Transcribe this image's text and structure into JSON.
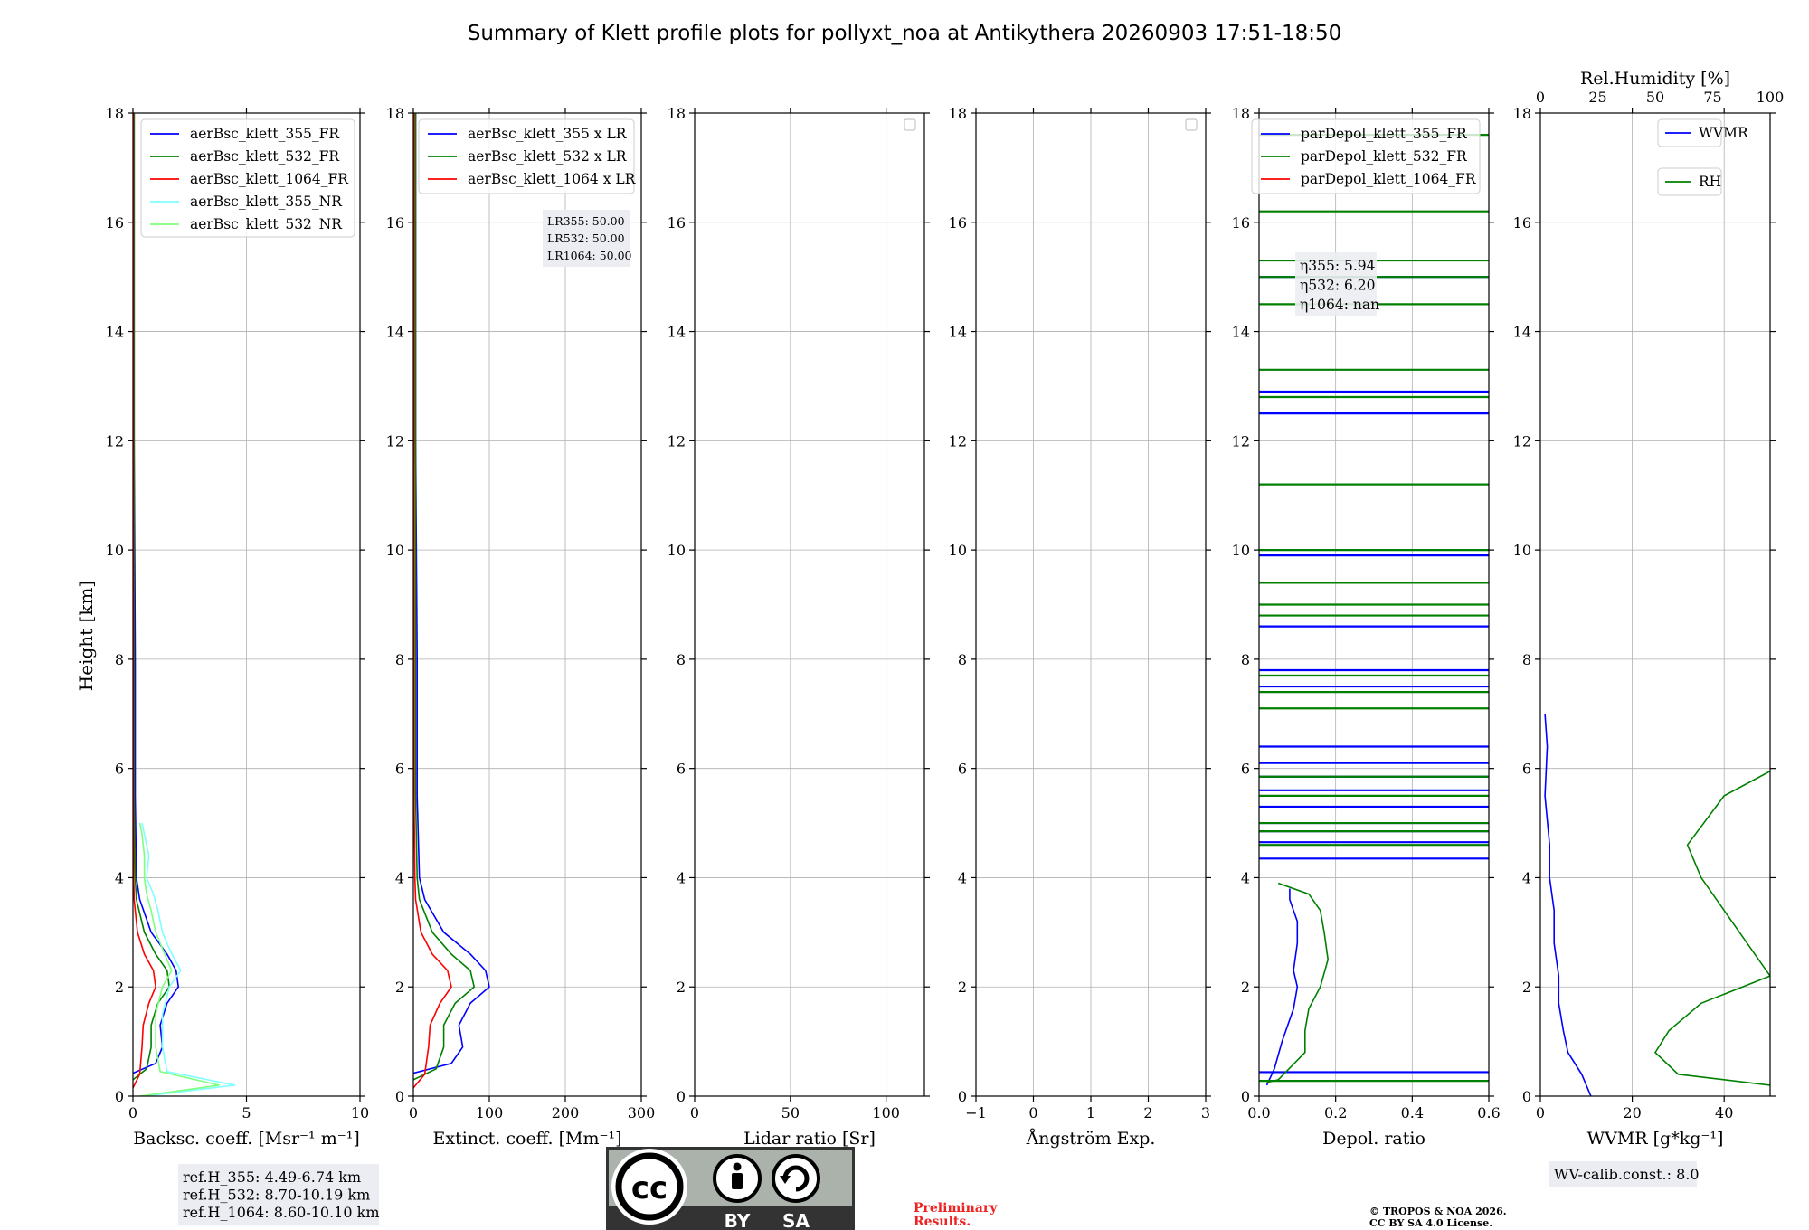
{
  "title": "Summary of Klett profile plots for pollyxt_noa at Antikythera 20260903 17:51-18:50",
  "ylabel": "Height [km]",
  "colors": {
    "b355": "#0000ff",
    "b532": "#008000",
    "b1064": "#ff0000",
    "nr355": "#7fffff",
    "nr532": "#7fff7f",
    "wvmr": "#0000ff",
    "rh": "#008000",
    "preliminary": "#ee2222",
    "cc_bg": "#aab2ab",
    "cc_dark": "#333333"
  },
  "chart_data": [
    {
      "type": "line",
      "panel": "backscatter",
      "xlabel": "Backsc. coeff. [Msr⁻¹ m⁻¹]",
      "xlim": [
        0,
        10
      ],
      "xticks": [
        "0",
        "5",
        "10"
      ],
      "ylim": [
        0,
        18
      ],
      "yticks": [
        "0",
        "2",
        "4",
        "6",
        "8",
        "10",
        "12",
        "14",
        "16",
        "18"
      ],
      "grid": true,
      "legend_placement": "top-right",
      "series": [
        {
          "name": "aerBsc_klett_355_FR",
          "color_key": "b355",
          "x": [
            0,
            1.0,
            1.3,
            1.2,
            1.5,
            2.0,
            1.9,
            1.5,
            0.8,
            0.3,
            0.15,
            0.1,
            0.1,
            0.05,
            0.05
          ],
          "y": [
            0.42,
            0.6,
            0.9,
            1.3,
            1.7,
            2.0,
            2.3,
            2.6,
            3.0,
            3.6,
            4.0,
            5.5,
            8.0,
            12.0,
            18.0
          ]
        },
        {
          "name": "aerBsc_klett_532_FR",
          "color_key": "b532",
          "x": [
            0,
            0.6,
            0.8,
            0.8,
            1.1,
            1.6,
            1.5,
            1.0,
            0.5,
            0.15,
            0.1,
            0.05,
            0.05,
            0.05,
            0.05
          ],
          "y": [
            0.3,
            0.5,
            0.9,
            1.3,
            1.7,
            2.0,
            2.3,
            2.6,
            3.0,
            3.6,
            4.0,
            5.5,
            8.0,
            12.0,
            18.0
          ]
        },
        {
          "name": "aerBsc_klett_1064_FR",
          "color_key": "b1064",
          "x": [
            0,
            0.3,
            0.4,
            0.45,
            0.7,
            1.0,
            0.9,
            0.5,
            0.2,
            0.05,
            0.03,
            0.02,
            0.02,
            0.02,
            0.02
          ],
          "y": [
            0.15,
            0.4,
            0.9,
            1.3,
            1.7,
            2.0,
            2.3,
            2.6,
            3.0,
            3.6,
            4.0,
            5.5,
            8.0,
            12.0,
            18.0
          ]
        },
        {
          "name": "aerBsc_klett_355_NR",
          "color_key": "nr355",
          "x": [
            0.5,
            4.5,
            1.5,
            1.3,
            1.3,
            1.6,
            2.1,
            1.6,
            1.3,
            1.1,
            0.9,
            0.6,
            0.7,
            0.5,
            0.4
          ],
          "y": [
            0.0,
            0.2,
            0.45,
            0.9,
            1.5,
            2.0,
            2.3,
            2.7,
            3.0,
            3.4,
            3.7,
            4.0,
            4.4,
            4.8,
            5.0
          ]
        },
        {
          "name": "aerBsc_klett_532_NR",
          "color_key": "nr532",
          "x": [
            0.3,
            3.8,
            1.2,
            1.0,
            1.0,
            1.3,
            1.7,
            1.3,
            1.0,
            0.8,
            0.6,
            0.5,
            0.5,
            0.4,
            0.3
          ],
          "y": [
            0.0,
            0.2,
            0.45,
            0.9,
            1.5,
            2.0,
            2.3,
            2.7,
            3.0,
            3.4,
            3.7,
            4.0,
            4.4,
            4.8,
            5.0
          ]
        }
      ],
      "annotation": [
        "ref.H_355: 4.49-6.74 km",
        "ref.H_532: 8.70-10.19 km",
        "ref.H_1064: 8.60-10.10 km"
      ]
    },
    {
      "type": "line",
      "panel": "extinction",
      "xlabel": "Extinct. coeff. [Mm⁻¹]",
      "xlim": [
        0,
        300
      ],
      "xticks": [
        "0",
        "100",
        "200",
        "300"
      ],
      "ylim": [
        0,
        18
      ],
      "yticks": [
        "0",
        "2",
        "4",
        "6",
        "8",
        "10",
        "12",
        "14",
        "16",
        "18"
      ],
      "grid": true,
      "legend_placement": "top-right",
      "series": [
        {
          "name": "aerBsc_klett_355 x LR",
          "color_key": "b355",
          "x": [
            0,
            50,
            65,
            60,
            75,
            100,
            95,
            75,
            40,
            15,
            8,
            5,
            5,
            3,
            3
          ],
          "y": [
            0.42,
            0.6,
            0.9,
            1.3,
            1.7,
            2.0,
            2.3,
            2.6,
            3.0,
            3.6,
            4.0,
            5.5,
            8.0,
            12.0,
            18.0
          ]
        },
        {
          "name": "aerBsc_klett_532 x LR",
          "color_key": "b532",
          "x": [
            0,
            30,
            40,
            40,
            55,
            80,
            75,
            50,
            25,
            8,
            5,
            3,
            3,
            3,
            3
          ],
          "y": [
            0.3,
            0.5,
            0.9,
            1.3,
            1.7,
            2.0,
            2.3,
            2.6,
            3.0,
            3.6,
            4.0,
            5.5,
            8.0,
            12.0,
            18.0
          ]
        },
        {
          "name": "aerBsc_klett_1064 x LR",
          "color_key": "b1064",
          "x": [
            0,
            15,
            20,
            22,
            35,
            50,
            45,
            25,
            10,
            3,
            2,
            1,
            1,
            1,
            1
          ],
          "y": [
            0.15,
            0.4,
            0.9,
            1.3,
            1.7,
            2.0,
            2.3,
            2.6,
            3.0,
            3.6,
            4.0,
            5.5,
            8.0,
            12.0,
            18.0
          ]
        }
      ],
      "annotation": [
        "LR355: 50.00",
        "LR532: 50.00",
        "LR1064: 50.00"
      ]
    },
    {
      "type": "line",
      "panel": "lidar-ratio",
      "xlabel": "Lidar ratio [Sr]",
      "xlim": [
        0,
        120
      ],
      "xticks": [
        "0",
        "50",
        "100"
      ],
      "ylim": [
        0,
        18
      ],
      "yticks": [
        "0",
        "2",
        "4",
        "6",
        "8",
        "10",
        "12",
        "14",
        "16",
        "18"
      ],
      "grid": true,
      "series": []
    },
    {
      "type": "line",
      "panel": "angstrom",
      "xlabel": "Ångström Exp.",
      "xlim": [
        -1,
        3
      ],
      "xticks": [
        "−1",
        "0",
        "1",
        "2",
        "3"
      ],
      "ylim": [
        0,
        18
      ],
      "yticks": [
        "0",
        "2",
        "4",
        "6",
        "8",
        "10",
        "12",
        "14",
        "16",
        "18"
      ],
      "grid": true,
      "series": []
    },
    {
      "type": "line",
      "panel": "depol",
      "xlabel": "Depol. ratio",
      "xlim": [
        0,
        0.6
      ],
      "xticks": [
        "0.0",
        "0.2",
        "0.4",
        "0.6"
      ],
      "ylim": [
        0,
        18
      ],
      "yticks": [
        "0",
        "2",
        "4",
        "6",
        "8",
        "10",
        "12",
        "14",
        "16",
        "18"
      ],
      "grid": true,
      "legend_placement": "top-right",
      "series": [
        {
          "name": "parDepol_klett_355_FR",
          "color_key": "b355",
          "x": [
            0.02,
            0.03,
            0.04,
            0.06,
            0.09,
            0.1,
            0.09,
            0.1,
            0.1,
            0.08,
            0.08
          ],
          "y": [
            0.2,
            0.35,
            0.5,
            1.0,
            1.6,
            2.0,
            2.3,
            2.8,
            3.2,
            3.6,
            3.8
          ],
          "spikes": [
            0.44,
            4.35,
            4.65,
            4.85,
            5.0,
            5.3,
            5.6,
            5.85,
            6.1,
            6.4,
            7.5,
            7.8,
            8.6,
            9.9,
            12.5,
            12.9,
            15.0
          ]
        },
        {
          "name": "parDepol_klett_532_FR",
          "color_key": "b532",
          "x": [
            0.02,
            0.05,
            0.12,
            0.12,
            0.13,
            0.16,
            0.18,
            0.17,
            0.16,
            0.13,
            0.05
          ],
          "y": [
            0.25,
            0.3,
            0.8,
            1.2,
            1.6,
            2.0,
            2.5,
            3.0,
            3.4,
            3.7,
            3.9
          ],
          "spikes": [
            0.28,
            4.6,
            4.85,
            5.0,
            5.5,
            5.85,
            7.1,
            7.4,
            7.7,
            8.8,
            9.0,
            9.4,
            10.0,
            11.2,
            12.8,
            13.3,
            14.5,
            15.0,
            15.3,
            16.2,
            17.6
          ]
        },
        {
          "name": "parDepol_klett_1064_FR",
          "color_key": "b1064",
          "x": [],
          "y": []
        }
      ],
      "annotation": [
        "η355: 5.94",
        "η532: 6.20",
        "η1064: nan"
      ]
    },
    {
      "type": "line",
      "panel": "wvmr",
      "xlabel": "WVMR [g*kg⁻¹]",
      "xlim": [
        0,
        50
      ],
      "xticks": [
        "0",
        "20",
        "40"
      ],
      "top_xlabel": "Rel.Humidity [%]",
      "top_xlim": [
        0,
        100
      ],
      "top_xticks": [
        "0",
        "25",
        "50",
        "75",
        "100"
      ],
      "ylim": [
        0,
        18
      ],
      "yticks": [
        "0",
        "2",
        "4",
        "6",
        "8",
        "10",
        "12",
        "14",
        "16",
        "18"
      ],
      "grid": true,
      "legend_placement": "top-right",
      "series": [
        {
          "name": "WVMR",
          "color_key": "wvmr",
          "x": [
            11,
            10,
            9,
            6,
            5,
            4,
            4,
            3,
            3,
            2,
            2,
            1,
            1.5,
            1
          ],
          "y": [
            0.0,
            0.2,
            0.4,
            0.8,
            1.2,
            1.7,
            2.2,
            2.8,
            3.4,
            4.0,
            4.6,
            5.5,
            6.4,
            7.0
          ]
        },
        {
          "name": "RH",
          "color_key": "rh",
          "x": [
            54,
            50,
            30,
            25,
            28,
            35,
            50,
            45,
            40,
            35,
            32,
            40,
            60,
            100
          ],
          "y": [
            0.0,
            0.2,
            0.4,
            0.8,
            1.2,
            1.7,
            2.2,
            2.8,
            3.4,
            4.0,
            4.6,
            5.5,
            6.4,
            7.0
          ]
        }
      ],
      "annotation": [
        "WV-calib.const.: 8.0"
      ]
    }
  ],
  "footer": {
    "cc_badge": {
      "letters": "cc",
      "by": "BY",
      "sa": "SA"
    },
    "preliminary": [
      "Preliminary",
      "Results."
    ],
    "copyright": [
      "© TROPOS & NOA 2026.",
      "CC BY SA 4.0 License."
    ]
  }
}
